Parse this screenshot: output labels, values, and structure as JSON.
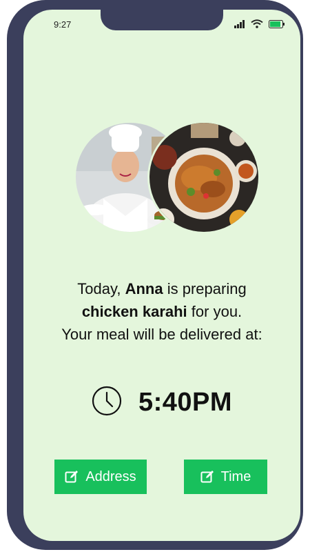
{
  "status_bar": {
    "time": "9:27",
    "icons": [
      "signal-icon",
      "wifi-icon",
      "battery-icon"
    ]
  },
  "images": {
    "chef_photo": "chef-photo",
    "food_photo": "food-photo"
  },
  "message": {
    "line1_prefix": "Today, ",
    "chef_name": "Anna",
    "line1_suffix": " is preparing",
    "dish": "chicken karahi",
    "line2_suffix": " for you.",
    "line3": "Your meal will be delivered at:"
  },
  "delivery": {
    "icon": "clock-icon",
    "time": "5:40PM"
  },
  "buttons": {
    "address_label": "Address",
    "time_label": "Time",
    "icon": "edit-icon"
  },
  "colors": {
    "phone_frame": "#3b3f5c",
    "screen_background": "#e4f6dc",
    "button_accent": "#18c05c"
  }
}
